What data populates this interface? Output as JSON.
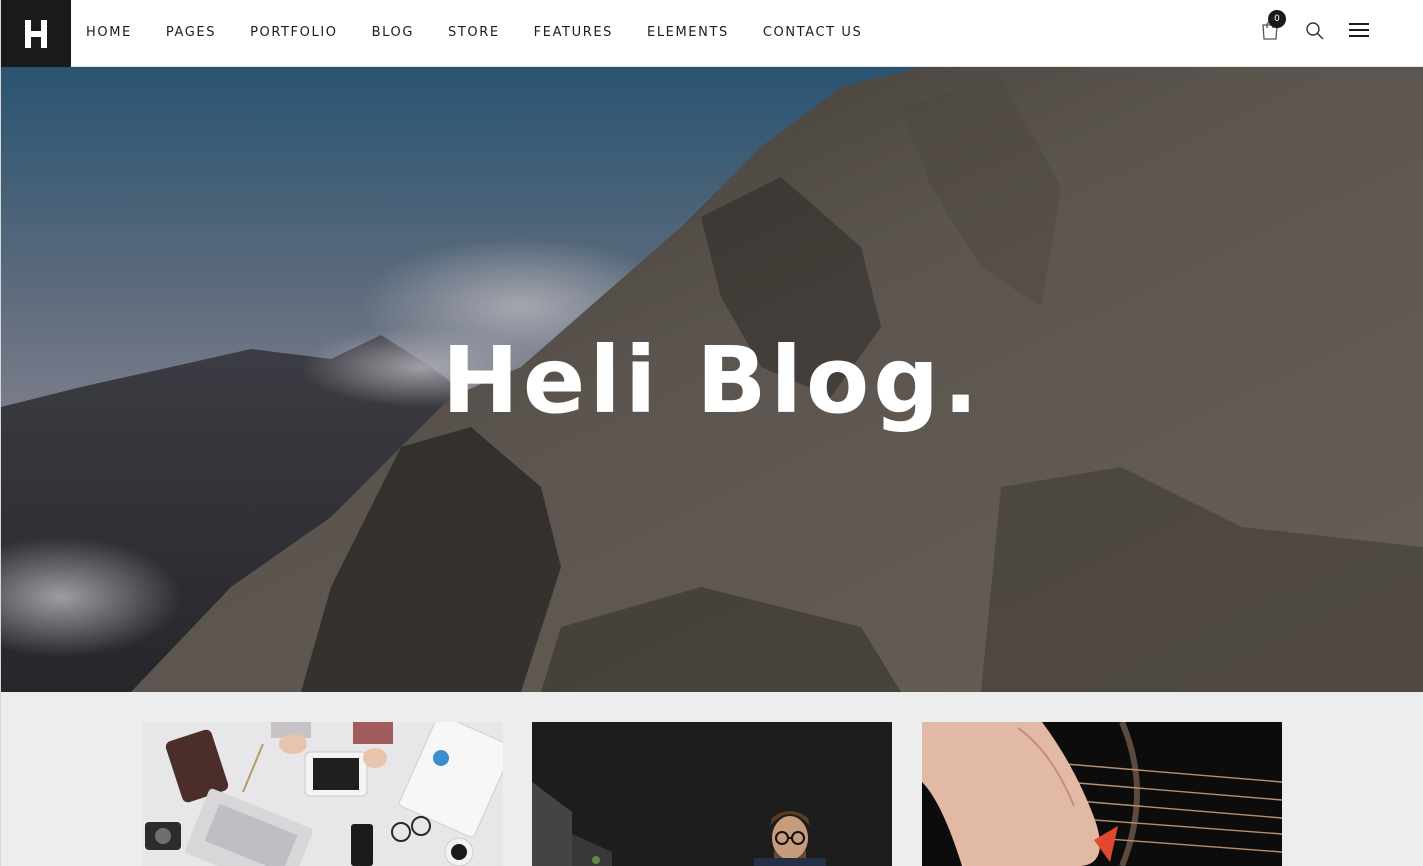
{
  "brand": {
    "logo_letter": "H"
  },
  "nav": {
    "items": [
      {
        "label": "HOME"
      },
      {
        "label": "PAGES"
      },
      {
        "label": "PORTFOLIO"
      },
      {
        "label": "BLOG"
      },
      {
        "label": "STORE"
      },
      {
        "label": "FEATURES"
      },
      {
        "label": "ELEMENTS"
      },
      {
        "label": "CONTACT US"
      }
    ]
  },
  "tools": {
    "cart_count": "0",
    "cart_icon": "shopping-bag-icon",
    "search_icon": "search-icon",
    "menu_icon": "hamburger-menu-icon"
  },
  "hero": {
    "title": "Heli Blog.",
    "background": "mountain-ridge-photo"
  },
  "cards": [
    {
      "image": "workspace-desk-flatlay-photo"
    },
    {
      "image": "man-with-glasses-working-photo"
    },
    {
      "image": "hand-playing-guitar-photo"
    }
  ],
  "colors": {
    "header_bg": "#ffffff",
    "logo_bg": "#1a1a1a",
    "nav_text": "#1d1d1d",
    "hero_text": "#ffffff",
    "page_bg": "#ededed"
  }
}
